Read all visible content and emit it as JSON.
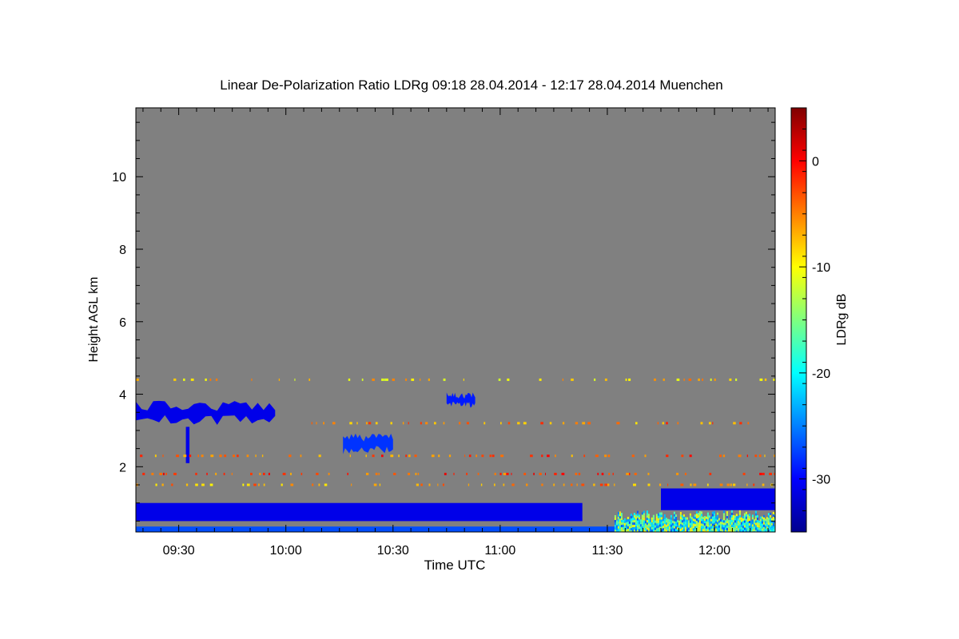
{
  "chart_data": {
    "type": "heatmap",
    "title": "Linear De-Polarization Ratio LDRg   09:18 28.04.2014 - 12:17 28.04.2014 Muenchen",
    "xlabel": "Time UTC",
    "ylabel": "Height AGL km",
    "colorbar_label": "LDRg dB",
    "x_range_minutes_utc": [
      558,
      737
    ],
    "y_range_km": [
      0.2,
      11.9
    ],
    "x_ticks": [
      {
        "label": "09:30",
        "value": 570
      },
      {
        "label": "10:00",
        "value": 600
      },
      {
        "label": "10:30",
        "value": 630
      },
      {
        "label": "11:00",
        "value": 660
      },
      {
        "label": "11:30",
        "value": 690
      },
      {
        "label": "12:00",
        "value": 720
      }
    ],
    "y_ticks": [
      {
        "label": "2",
        "value": 2
      },
      {
        "label": "4",
        "value": 4
      },
      {
        "label": "6",
        "value": 6
      },
      {
        "label": "8",
        "value": 8
      },
      {
        "label": "10",
        "value": 10
      }
    ],
    "colorbar_range_db": [
      -35,
      5
    ],
    "colorbar_ticks": [
      {
        "label": "0",
        "value": 0
      },
      {
        "label": "-10",
        "value": -10
      },
      {
        "label": "-20",
        "value": -20
      },
      {
        "label": "-30",
        "value": -30
      }
    ],
    "no_data_color": "#808080",
    "features": [
      {
        "name": "cloud layer",
        "t": [
          558,
          597
        ],
        "h": [
          3.1,
          3.9
        ],
        "ldr": -31
      },
      {
        "name": "virga streak",
        "t": [
          572,
          573
        ],
        "h": [
          2.1,
          3.1
        ],
        "ldr": -31
      },
      {
        "name": "cloud patch",
        "t": [
          616,
          630
        ],
        "h": [
          2.3,
          3.0
        ],
        "ldr": -28
      },
      {
        "name": "cloud fragment",
        "t": [
          645,
          653
        ],
        "h": [
          3.6,
          4.1
        ],
        "ldr": -29
      },
      {
        "name": "boundary layer",
        "t": [
          558,
          683
        ],
        "h": [
          0.5,
          1.0
        ],
        "ldr": -31
      },
      {
        "name": "surface layer",
        "t": [
          558,
          737
        ],
        "h": [
          0.2,
          0.35
        ],
        "ldr": -27
      },
      {
        "name": "upper layer right",
        "t": [
          705,
          737
        ],
        "h": [
          0.8,
          1.4
        ],
        "ldr": -31
      },
      {
        "name": "aerosol mixed",
        "t": [
          692,
          737
        ],
        "h": [
          0.2,
          0.8
        ],
        "ldr": -18
      },
      {
        "name": "speckle 4.4 km",
        "t": [
          558,
          737
        ],
        "h": [
          4.4,
          4.4
        ],
        "ldr": -8
      },
      {
        "name": "speckle 3.2 km",
        "t": [
          600,
          730
        ],
        "h": [
          3.2,
          3.2
        ],
        "ldr": -5
      },
      {
        "name": "speckle 2.3 km",
        "t": [
          558,
          737
        ],
        "h": [
          2.3,
          2.3
        ],
        "ldr": -4
      },
      {
        "name": "speckle 1.8 km",
        "t": [
          558,
          737
        ],
        "h": [
          1.8,
          1.8
        ],
        "ldr": -3
      },
      {
        "name": "speckle 1.5 km",
        "t": [
          558,
          737
        ],
        "h": [
          1.5,
          1.5
        ],
        "ldr": -6
      }
    ]
  }
}
